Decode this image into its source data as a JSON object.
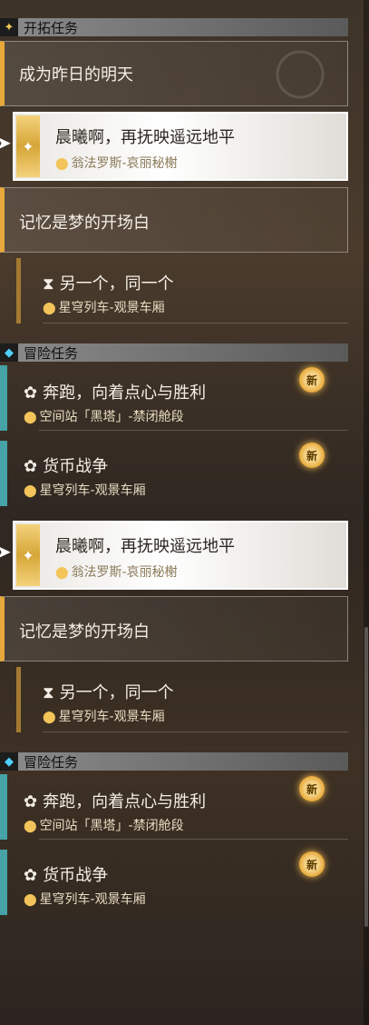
{
  "categories": {
    "trailblaze": "开拓任务",
    "adventure": "冒险任务"
  },
  "icons": {
    "trailblaze": "diamond-star-icon",
    "adventure": "diamond-icon",
    "location": "location-pin-icon",
    "hourglass": "hourglass-icon",
    "adventure_mission": "hand-icon",
    "new_badge": "new-badge-icon"
  },
  "missions": {
    "chapter": "成为昨日的明天",
    "current": {
      "title": "晨曦啊，再抚映遥远地平",
      "location": "翁法罗斯-哀丽秘榭"
    },
    "memory": "记忆是梦的开场白",
    "another": {
      "title": "另一个，同一个",
      "location": "星穹列车-观景车厢"
    },
    "run": {
      "title": "奔跑，向着点心与胜利",
      "location": "空间站「黑塔」-禁闭舱段"
    },
    "currency": {
      "title": "货币战争",
      "location": "星穹列车-观景车厢"
    }
  },
  "badge": "新"
}
